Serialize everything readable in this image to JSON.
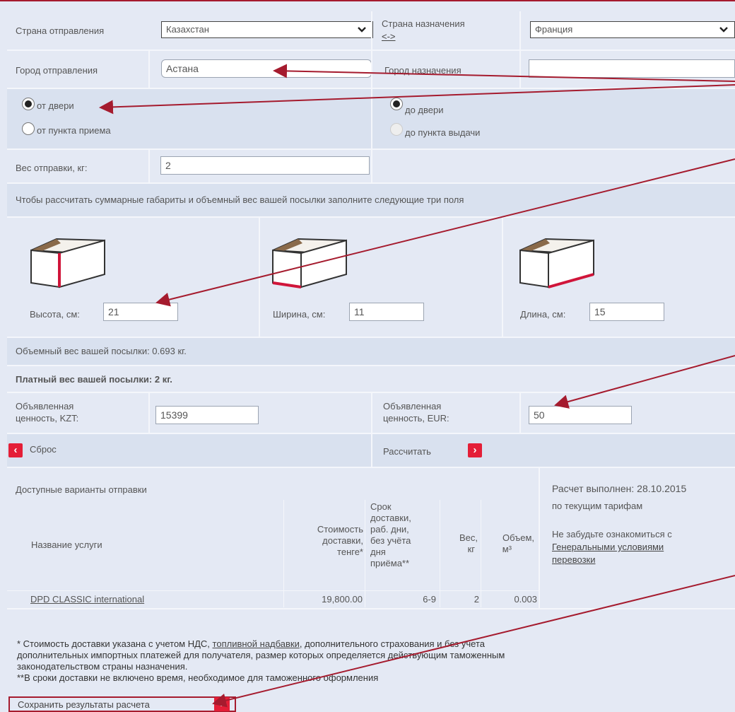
{
  "form": {
    "origin_country_label": "Страна отправления",
    "origin_country_value": "Казахстан",
    "dest_country_label": "Страна назначения",
    "swap_label": "<->",
    "dest_country_value": "Франция",
    "origin_city_label": "Город отправления",
    "origin_city_value": "Астана",
    "dest_city_label": "Город назначения",
    "dest_city_value": "",
    "from_door_label": "от двери",
    "from_point_label": "от пункта приема",
    "to_door_label": "до двери",
    "to_point_label": "до пункта выдачи",
    "weight_label": "Вес отправки, кг:",
    "weight_value": "2",
    "dimensions_hint": "Чтобы рассчитать суммарные габариты и объемный вес вашей посылки заполните следующие три поля",
    "height_label": "Высота, см:",
    "height_value": "21",
    "width_label": "Ширина, см:",
    "width_value": "11",
    "length_label": "Длина, см:",
    "length_value": "15",
    "volume_weight_text": "Объемный вес вашей посылки: 0.693 кг.",
    "paid_weight_text": "Платный вес вашей посылки: 2 кг.",
    "declared_kzt_label_1": "Объявленная",
    "declared_kzt_label_2": "ценность, KZT:",
    "declared_kzt_value": "15399",
    "declared_eur_label_1": "Объявленная",
    "declared_eur_label_2": "ценность, EUR:",
    "declared_eur_value": "50",
    "reset_label": "Сброс",
    "calculate_label": "Рассчитать"
  },
  "results": {
    "heading": "Доступные варианты отправки",
    "columns": {
      "service": "Название услуги",
      "cost": [
        "Стоимость",
        "доставки,",
        "тенге*"
      ],
      "term": [
        "Срок",
        "доставки,",
        "раб. дни,",
        "без учёта",
        "дня",
        "приёма**"
      ],
      "weight": [
        "Вес,",
        "кг"
      ],
      "volume": [
        "Объем,",
        "м³"
      ]
    },
    "rows": [
      {
        "service": "DPD CLASSIC international",
        "cost": "19,800.00",
        "term": "6-9",
        "weight": "2",
        "volume": "0.003"
      }
    ],
    "side_date": "Расчет выполнен: 28.10.2015",
    "side_tariffs": "по текущим тарифам",
    "side_reminder": "Не забудьте ознакомиться с",
    "side_link_1": "Генеральными условиями",
    "side_link_2": "перевозки"
  },
  "footnotes": {
    "line1_a": "* Стоимость доставки указана с учетом НДС, ",
    "line1_link": "топливной надбавки",
    "line1_b": ", дополнительного страхования и без учета",
    "line2": "дополнительных импортных платежей для получателя, размер которых определяется действующим таможенным",
    "line3": "законодательством страны назначения.",
    "line4": "**В сроки доставки не включено время, необходимое для таможенного оформления"
  },
  "save_label": "Сохранить результаты расчета",
  "colors": {
    "accent": "#e41e37",
    "arrow": "#a51b2e",
    "row_bg": "#e4e9f4"
  },
  "icons": [
    "chevron-down-icon",
    "chevron-left-icon",
    "chevron-right-icon",
    "box-icon"
  ]
}
